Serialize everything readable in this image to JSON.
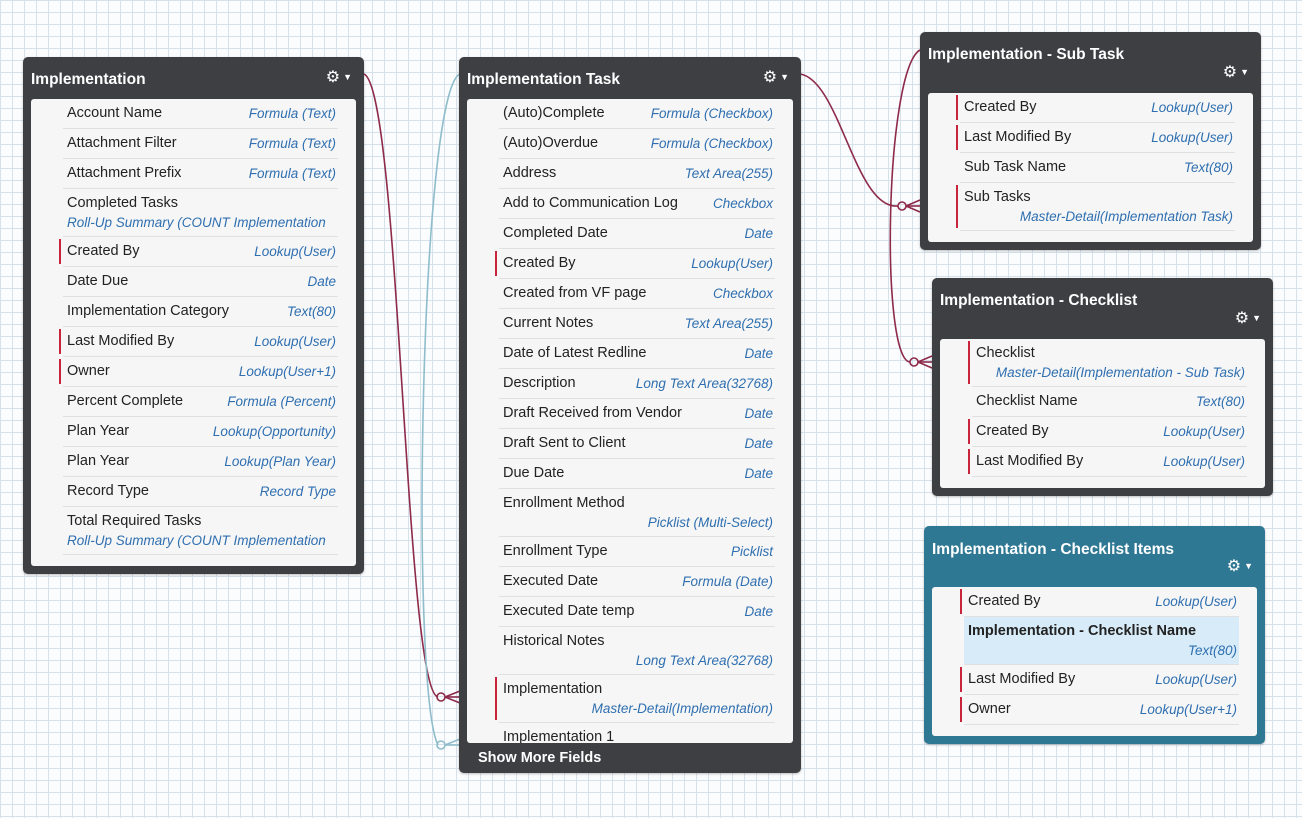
{
  "objects": [
    {
      "id": "implementation",
      "title": "Implementation",
      "fields": [
        {
          "name": "Account Name",
          "type": "Formula (Text)",
          "required": false
        },
        {
          "name": "Attachment Filter",
          "type": "Formula (Text)",
          "required": false
        },
        {
          "name": "Attachment Prefix",
          "type": "Formula (Text)",
          "required": false
        },
        {
          "name": "Completed Tasks",
          "type": "Roll-Up Summary (COUNT Implementation",
          "required": false,
          "two_line": true,
          "left_type": true
        },
        {
          "name": "Created By",
          "type": "Lookup(User)",
          "required": true
        },
        {
          "name": "Date Due",
          "type": "Date",
          "required": false
        },
        {
          "name": "Implementation Category",
          "type": "Text(80)",
          "required": false
        },
        {
          "name": "Last Modified By",
          "type": "Lookup(User)",
          "required": true
        },
        {
          "name": "Owner",
          "type": "Lookup(User+1)",
          "required": true
        },
        {
          "name": "Percent Complete",
          "type": "Formula (Percent)",
          "required": false
        },
        {
          "name": "Plan Year",
          "type": "Lookup(Opportunity)",
          "required": false
        },
        {
          "name": "Plan Year",
          "type": "Lookup(Plan Year)",
          "required": false
        },
        {
          "name": "Record Type",
          "type": "Record Type",
          "required": false
        },
        {
          "name": "Total Required Tasks",
          "type": "Roll-Up Summary (COUNT Implementation",
          "required": false,
          "two_line": true,
          "left_type": true
        }
      ]
    },
    {
      "id": "implementation-task",
      "title": "Implementation Task",
      "show_more": "Show More Fields",
      "fields": [
        {
          "name": "(Auto)Complete",
          "type": "Formula (Checkbox)",
          "required": false
        },
        {
          "name": "(Auto)Overdue",
          "type": "Formula (Checkbox)",
          "required": false
        },
        {
          "name": "Address",
          "type": "Text Area(255)",
          "required": false
        },
        {
          "name": "Add to Communication Log",
          "type": "Checkbox",
          "required": false
        },
        {
          "name": "Completed Date",
          "type": "Date",
          "required": false
        },
        {
          "name": "Created By",
          "type": "Lookup(User)",
          "required": true
        },
        {
          "name": "Created from VF page",
          "type": "Checkbox",
          "required": false
        },
        {
          "name": "Current Notes",
          "type": "Text Area(255)",
          "required": false
        },
        {
          "name": "Date of Latest Redline",
          "type": "Date",
          "required": false
        },
        {
          "name": "Description",
          "type": "Long Text Area(32768)",
          "required": false
        },
        {
          "name": "Draft Received from Vendor",
          "type": "Date",
          "required": false
        },
        {
          "name": "Draft Sent to Client",
          "type": "Date",
          "required": false
        },
        {
          "name": "Due Date",
          "type": "Date",
          "required": false
        },
        {
          "name": "Enrollment Method",
          "type": "Picklist (Multi-Select)",
          "required": false,
          "two_line": true
        },
        {
          "name": "Enrollment Type",
          "type": "Picklist",
          "required": false
        },
        {
          "name": "Executed Date",
          "type": "Formula (Date)",
          "required": false
        },
        {
          "name": "Executed Date temp",
          "type": "Date",
          "required": false
        },
        {
          "name": "Historical Notes",
          "type": "Long Text Area(32768)",
          "required": false,
          "two_line": true
        },
        {
          "name": "Implementation",
          "type": "Master-Detail(Implementation)",
          "required": true,
          "two_line": true
        },
        {
          "name": "Implementation 1",
          "type": "",
          "required": false
        }
      ]
    },
    {
      "id": "implementation-sub-task",
      "title": "Implementation - Sub Task",
      "fields": [
        {
          "name": "Created By",
          "type": "Lookup(User)",
          "required": true
        },
        {
          "name": "Last Modified By",
          "type": "Lookup(User)",
          "required": true
        },
        {
          "name": "Sub Task Name",
          "type": "Text(80)",
          "required": false
        },
        {
          "name": "Sub Tasks",
          "type": "Master-Detail(Implementation Task)",
          "required": true,
          "two_line": true
        }
      ]
    },
    {
      "id": "implementation-checklist",
      "title": "Implementation - Checklist",
      "fields": [
        {
          "name": "Checklist",
          "type": "Master-Detail(Implementation - Sub Task)",
          "required": true,
          "two_line": true
        },
        {
          "name": "Checklist Name",
          "type": "Text(80)",
          "required": false
        },
        {
          "name": "Created By",
          "type": "Lookup(User)",
          "required": true
        },
        {
          "name": "Last Modified By",
          "type": "Lookup(User)",
          "required": true
        }
      ]
    },
    {
      "id": "implementation-checklist-items",
      "title": "Implementation - Checklist Items",
      "selected": true,
      "fields": [
        {
          "name": "Created By",
          "type": "Lookup(User)",
          "required": true
        },
        {
          "name": "Implementation - Checklist Name",
          "type": "Text(80)",
          "required": false,
          "two_line": true,
          "highlight": true
        },
        {
          "name": "Last Modified By",
          "type": "Lookup(User)",
          "required": true
        },
        {
          "name": "Owner",
          "type": "Lookup(User+1)",
          "required": true
        }
      ]
    }
  ],
  "icons": {
    "gear": "gear-icon",
    "caret": "caret-down-icon"
  },
  "colors": {
    "card_header": "#3d3f43",
    "selected_header": "#2f7894",
    "required_marker": "#c8253c",
    "type_text": "#2f6fb0",
    "master_detail_line": "#8e2a4a",
    "lookup_line": "#8fbdcc"
  }
}
